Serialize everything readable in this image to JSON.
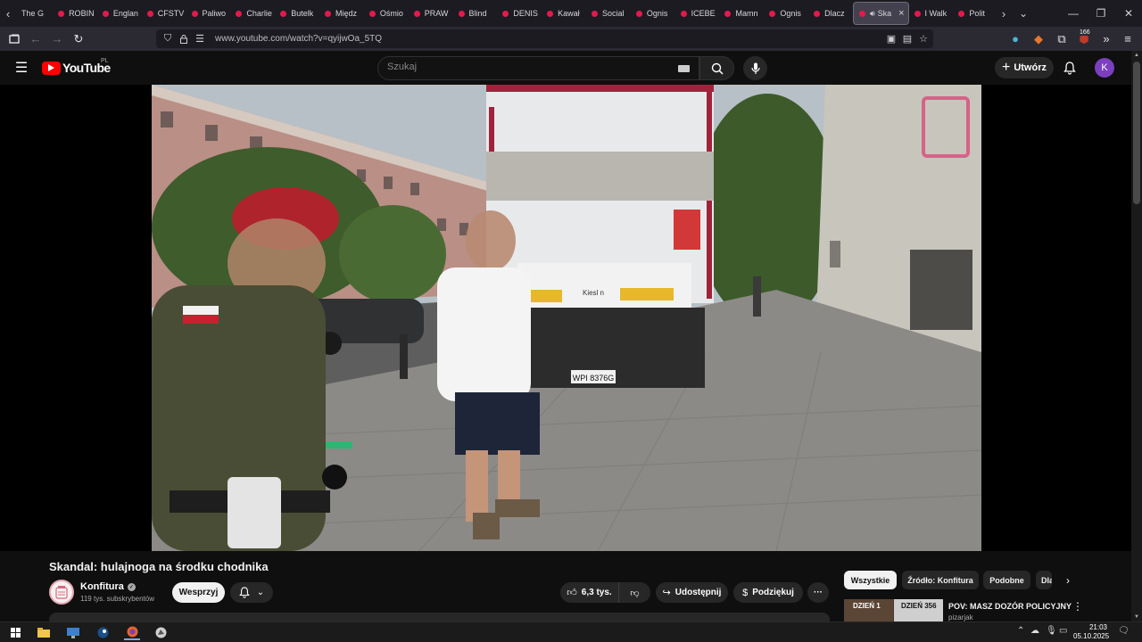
{
  "browser": {
    "tabs": [
      {
        "label": "The G",
        "active": false
      },
      {
        "label": "ROBIN",
        "active": false
      },
      {
        "label": "Englan",
        "active": false
      },
      {
        "label": "CFSTV",
        "active": false
      },
      {
        "label": "Paliwo",
        "active": false
      },
      {
        "label": "Charlie",
        "active": false
      },
      {
        "label": "Butelk",
        "active": false
      },
      {
        "label": "Międz",
        "active": false
      },
      {
        "label": "Ośmio",
        "active": false
      },
      {
        "label": "PRAW",
        "active": false
      },
      {
        "label": "Blind",
        "active": false
      },
      {
        "label": "DENIS",
        "active": false
      },
      {
        "label": "Kawał",
        "active": false
      },
      {
        "label": "Social",
        "active": false
      },
      {
        "label": "Ognis",
        "active": false
      },
      {
        "label": "ICEBE",
        "active": false
      },
      {
        "label": "Mamn",
        "active": false
      },
      {
        "label": "Ognis",
        "active": false
      },
      {
        "label": "Dlacz",
        "active": false
      },
      {
        "label": "Ska",
        "active": true
      },
      {
        "label": "I Walk",
        "active": false
      },
      {
        "label": "Polit",
        "active": false
      }
    ],
    "url": "www.youtube.com/watch?v=qyijwOa_5TQ",
    "extension_badge": "166"
  },
  "youtube": {
    "logo_text": "YouTube",
    "country_code": "PL",
    "search_placeholder": "Szukaj",
    "create_label": "Utwórz",
    "avatar_letter": "K"
  },
  "video": {
    "license_plate": "WPI 8376G",
    "truck_brand": "Kiesl n",
    "title": "Skandal: hulajnoga na środku chodnika",
    "channel_name": "Konfitura",
    "subscribers": "119 tys. subskrybentów",
    "support_label": "Wesprzyj",
    "likes": "6,3 tys.",
    "share_label": "Udostępnij",
    "thanks_label": "Podziękuj"
  },
  "chips": [
    "Wszystkie",
    "Źródło: Konfitura",
    "Podobne",
    "Dla"
  ],
  "recommended": {
    "thumb_left": "DZIEŃ 1",
    "thumb_right": "DZIEŃ 356",
    "title": "POV: MASZ DOZÓR POLICYJNY",
    "channel": "pizarjak"
  },
  "taskbar": {
    "time": "21:03",
    "date": "05.10.2025"
  },
  "colors": {
    "yt_red": "#ff0000",
    "tab_favicon": "#e31a4b",
    "avatar_bg": "#7b3fbf",
    "background": "#0f0f0f"
  }
}
